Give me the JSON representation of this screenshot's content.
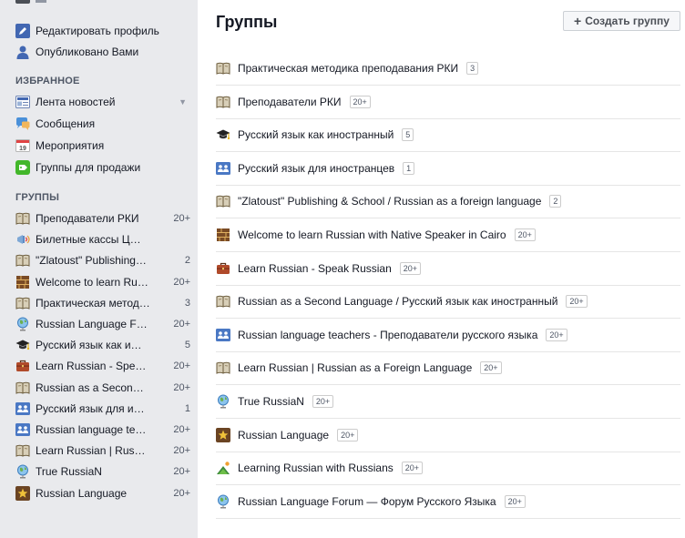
{
  "sidebar": {
    "top_items": [
      {
        "label": "Редактировать профиль",
        "icon": "pencil-icon"
      },
      {
        "label": "Опубликовано Вами",
        "icon": "user-icon"
      }
    ],
    "favorites_header": "ИЗБРАННОЕ",
    "favorites": [
      {
        "label": "Лента новостей",
        "icon": "newsfeed-icon"
      },
      {
        "label": "Сообщения",
        "icon": "messages-icon"
      },
      {
        "label": "Мероприятия",
        "icon": "calendar-icon",
        "calendar_number": "19"
      },
      {
        "label": "Группы для продажи",
        "icon": "sale-groups-icon"
      }
    ],
    "groups_header": "ГРУППЫ",
    "groups": [
      {
        "label": "Преподаватели РКИ",
        "count": "20+",
        "icon": "book-icon"
      },
      {
        "label": "Билетные кассы Ц…",
        "count": "",
        "icon": "megaphone-icon"
      },
      {
        "label": "\"Zlatoust\" Publishing…",
        "count": "2",
        "icon": "book-icon"
      },
      {
        "label": "Welcome to learn Ru…",
        "count": "20+",
        "icon": "brick-icon"
      },
      {
        "label": "Практическая метод…",
        "count": "3",
        "icon": "book-icon"
      },
      {
        "label": "Russian Language F…",
        "count": "20+",
        "icon": "globe-icon"
      },
      {
        "label": "Русский язык как и…",
        "count": "5",
        "icon": "graduation-cap-icon"
      },
      {
        "label": "Learn Russian - Spe…",
        "count": "20+",
        "icon": "briefcase-icon"
      },
      {
        "label": "Russian as a Secon…",
        "count": "20+",
        "icon": "book-icon"
      },
      {
        "label": "Русский язык для и…",
        "count": "1",
        "icon": "group-people-icon"
      },
      {
        "label": "Russian language te…",
        "count": "20+",
        "icon": "group-people-icon"
      },
      {
        "label": "Learn Russian | Rus…",
        "count": "20+",
        "icon": "book-icon"
      },
      {
        "label": "True RussiaN",
        "count": "20+",
        "icon": "globe-icon"
      },
      {
        "label": "Russian Language",
        "count": "20+",
        "icon": "star-icon"
      }
    ]
  },
  "main": {
    "title": "Группы",
    "create_button": {
      "plus": "+",
      "label": "Создать группу"
    },
    "groups": [
      {
        "name": "Практическая методика преподавания РКИ",
        "badge": "3",
        "icon": "book-icon"
      },
      {
        "name": "Преподаватели РКИ",
        "badge": "20+",
        "icon": "book-icon"
      },
      {
        "name": "Русский язык как иностранный",
        "badge": "5",
        "icon": "graduation-cap-icon"
      },
      {
        "name": "Русский язык для иностранцев",
        "badge": "1",
        "icon": "group-people-icon"
      },
      {
        "name": "\"Zlatoust\" Publishing & School / Russian as a foreign language",
        "badge": "2",
        "icon": "book-icon"
      },
      {
        "name": "Welcome to learn Russian with Native Speaker in Cairo",
        "badge": "20+",
        "icon": "brick-icon"
      },
      {
        "name": "Learn Russian - Speak Russian",
        "badge": "20+",
        "icon": "briefcase-icon"
      },
      {
        "name": "Russian as a Second Language / Русский язык как иностранный",
        "badge": "20+",
        "icon": "book-icon"
      },
      {
        "name": "Russian language teachers - Преподаватели русского языка",
        "badge": "20+",
        "icon": "group-people-icon"
      },
      {
        "name": "Learn Russian | Russian as a Foreign Language",
        "badge": "20+",
        "icon": "book-icon"
      },
      {
        "name": "True RussiaN",
        "badge": "20+",
        "icon": "globe-icon"
      },
      {
        "name": "Russian Language",
        "badge": "20+",
        "icon": "star-icon"
      },
      {
        "name": "Learning Russian with Russians",
        "badge": "20+",
        "icon": "house-icon"
      },
      {
        "name": "Russian Language Forum — Форум Русского Языка",
        "badge": "20+",
        "icon": "globe-icon"
      }
    ]
  },
  "colors": {
    "sidebar_bg": "#e9eaed",
    "divider": "#e5e5e5",
    "text": "#141823",
    "muted": "#4e5665"
  }
}
